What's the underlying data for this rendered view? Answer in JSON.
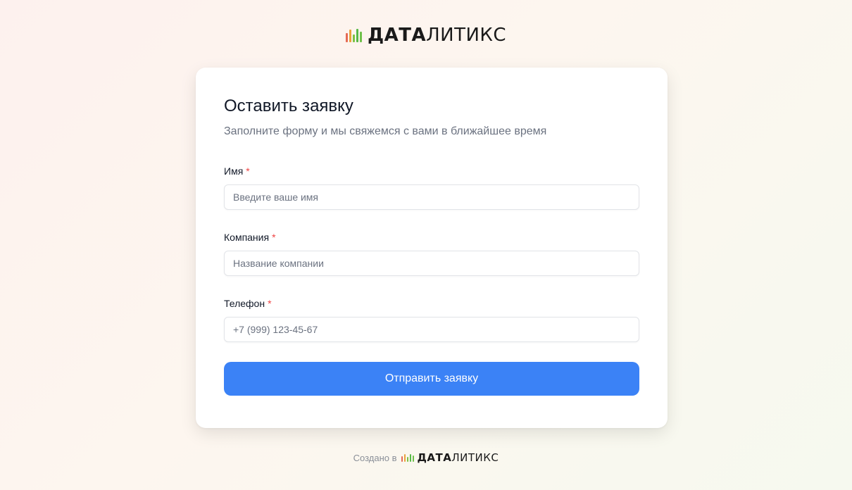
{
  "brand": {
    "name_bold": "ДАТА",
    "name_light": "ЛИТИКС"
  },
  "form": {
    "title": "Оставить заявку",
    "subtitle": "Заполните форму и мы свяжемся с вами в ближайшее время",
    "required_mark": "*",
    "fields": {
      "name": {
        "label": "Имя",
        "value": "",
        "placeholder": "Введите ваше имя"
      },
      "company": {
        "label": "Компания",
        "value": "",
        "placeholder": "Название компании"
      },
      "phone": {
        "label": "Телефон",
        "value": "",
        "placeholder": "+7 (999) 123-45-67"
      }
    },
    "submit_label": "Отправить заявку"
  },
  "footer": {
    "created_in": "Создано в"
  },
  "colors": {
    "accent": "#3b82f6",
    "required": "#ef4444",
    "logo_bars": [
      "#e56a55",
      "#e8a33c",
      "#7cc243",
      "#57b947",
      "#6fc04a"
    ]
  },
  "icons": {
    "logo": "bar-chart-logo-icon"
  }
}
